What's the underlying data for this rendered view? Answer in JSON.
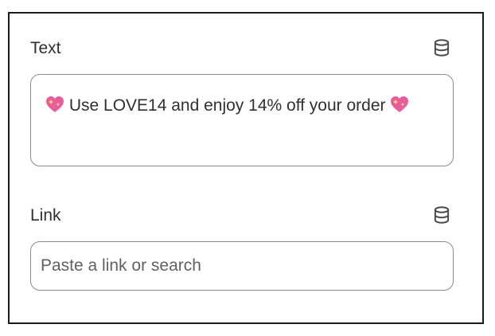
{
  "text_field": {
    "label": "Text",
    "icon": "database-icon",
    "value_prefix": " Use LOVE14 and enjoy 14% off your order ",
    "emoji": "sparkling-heart-icon"
  },
  "link_field": {
    "label": "Link",
    "icon": "database-icon",
    "placeholder": "Paste a link or search"
  },
  "colors": {
    "border": "#8a8a8a",
    "text": "#303030",
    "placeholder": "#616161",
    "heart": "#e85d9b"
  }
}
